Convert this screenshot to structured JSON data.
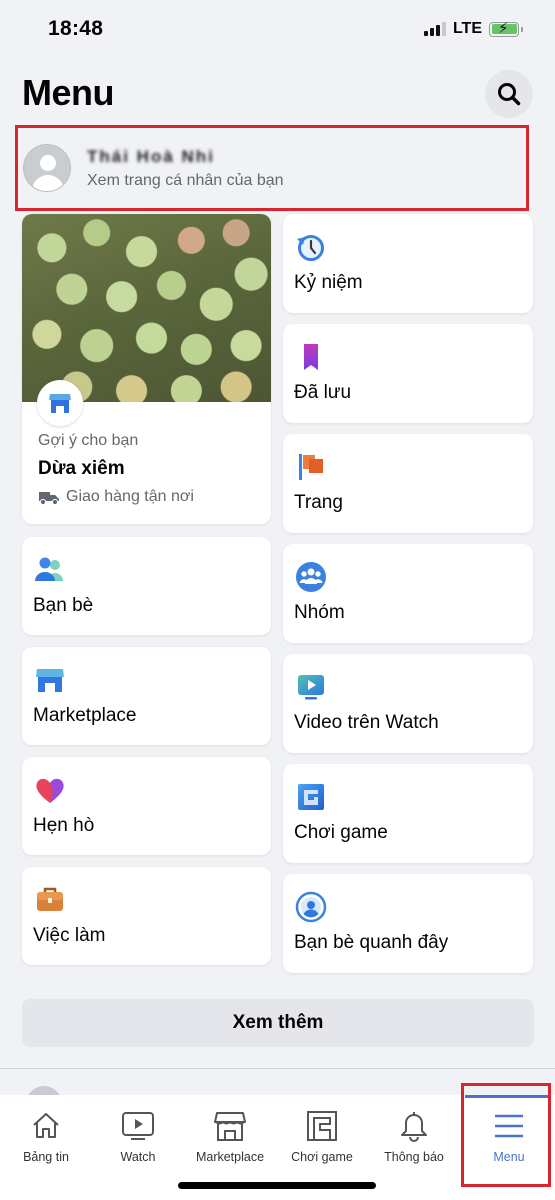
{
  "status_bar": {
    "time": "18:48",
    "network": "LTE",
    "icons": [
      "signal-icon",
      "battery-charging-icon"
    ]
  },
  "header": {
    "title": "Menu",
    "search_icon": "search-icon"
  },
  "profile": {
    "name": "Thái Hoà Nhi",
    "subtitle": "Xem trang cá nhân của bạn",
    "name_obscured": true
  },
  "featured": {
    "badge_icon": "marketplace-store-icon",
    "suggestion_label": "Gợi ý cho bạn",
    "product_name": "Dừa xiêm",
    "delivery_label": "Giao hàng tận nơi",
    "delivery_icon": "truck-icon"
  },
  "shortcuts": {
    "left": [
      {
        "label": "Bạn bè",
        "icon": "friends-icon"
      },
      {
        "label": "Marketplace",
        "icon": "marketplace-icon"
      },
      {
        "label": "Hẹn hò",
        "icon": "dating-heart-icon"
      },
      {
        "label": "Việc làm",
        "icon": "jobs-briefcase-icon"
      }
    ],
    "right": [
      {
        "label": "Kỷ niệm",
        "icon": "memories-clock-icon"
      },
      {
        "label": "Đã lưu",
        "icon": "saved-bookmark-icon"
      },
      {
        "label": "Trang",
        "icon": "pages-flag-icon"
      },
      {
        "label": "Nhóm",
        "icon": "groups-icon"
      },
      {
        "label": "Video trên Watch",
        "icon": "watch-video-icon"
      },
      {
        "label": "Chơi game",
        "icon": "gaming-icon"
      },
      {
        "label": "Bạn bè quanh đây",
        "icon": "nearby-friends-icon"
      }
    ]
  },
  "see_more_label": "Xem thêm",
  "tab_bar": {
    "active": "Menu",
    "accent_color": "#4a74c9",
    "tabs": [
      {
        "label": "Bảng tin",
        "icon": "home-icon"
      },
      {
        "label": "Watch",
        "icon": "watch-icon"
      },
      {
        "label": "Marketplace",
        "icon": "marketplace-icon"
      },
      {
        "label": "Chơi game",
        "icon": "gaming-icon"
      },
      {
        "label": "Thông báo",
        "icon": "bell-icon"
      },
      {
        "label": "Menu",
        "icon": "hamburger-menu-icon"
      }
    ]
  },
  "annotation_color": "#d9262e"
}
